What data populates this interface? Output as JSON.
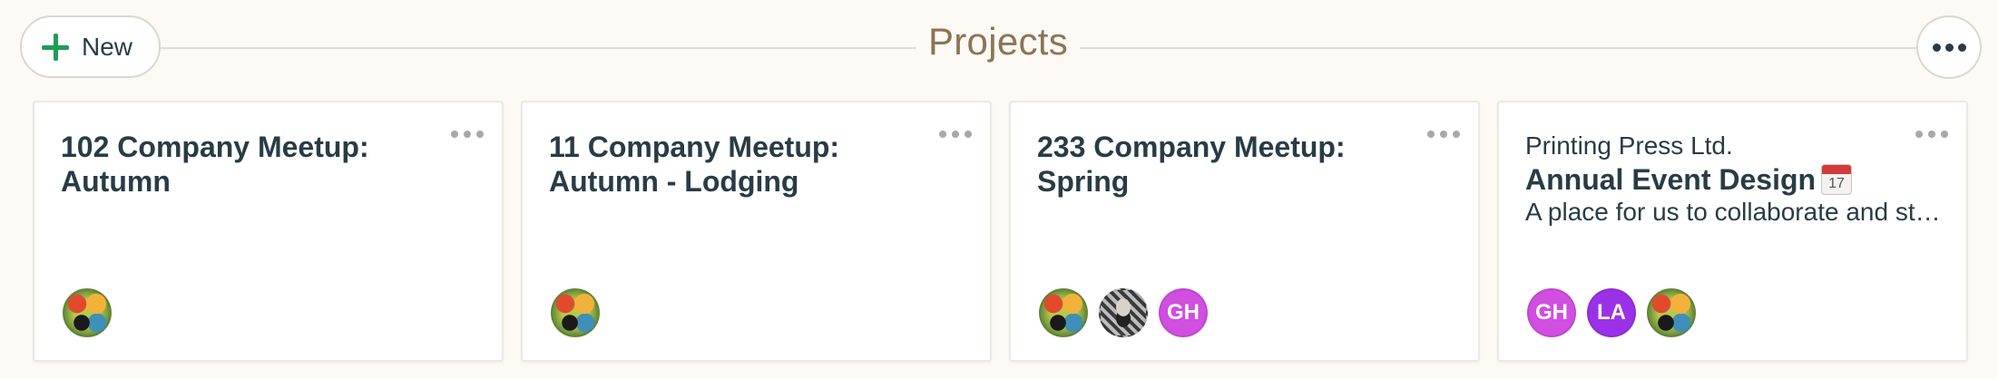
{
  "header": {
    "new_label": "New",
    "title": "Projects"
  },
  "cards": [
    {
      "title": "102 Company Meetup: Autumn",
      "members": [
        {
          "type": "photo",
          "name": "photo-avatar"
        }
      ]
    },
    {
      "title": "11 Company Meetup: Autumn - Lodging",
      "members": [
        {
          "type": "photo",
          "name": "photo-avatar"
        }
      ]
    },
    {
      "title": "233 Company Meetup: Spring",
      "members": [
        {
          "type": "photo",
          "name": "photo-avatar"
        },
        {
          "type": "photo",
          "name": "photo-avatar-bw"
        },
        {
          "type": "initials",
          "initials": "GH",
          "color": "#d04ee0"
        }
      ]
    },
    {
      "company": "Printing Press Ltd.",
      "title": "Annual Event Design",
      "calendar_day": "17",
      "description": "A place for us to collaborate and stay on top of the annual event design",
      "members": [
        {
          "type": "initials",
          "initials": "GH",
          "color": "#d04ee0"
        },
        {
          "type": "initials",
          "initials": "LA",
          "color": "#9b31e6"
        },
        {
          "type": "photo",
          "name": "photo-avatar"
        }
      ]
    }
  ],
  "colors": {
    "accent_green": "#1f9d55",
    "title_brown": "#8b7556",
    "text": "#283c46",
    "background": "#fdf9f5"
  },
  "icons": {
    "new": "plus-icon",
    "options": "ellipsis-icon",
    "card_menu": "ellipsis-icon",
    "calendar": "calendar-icon"
  }
}
